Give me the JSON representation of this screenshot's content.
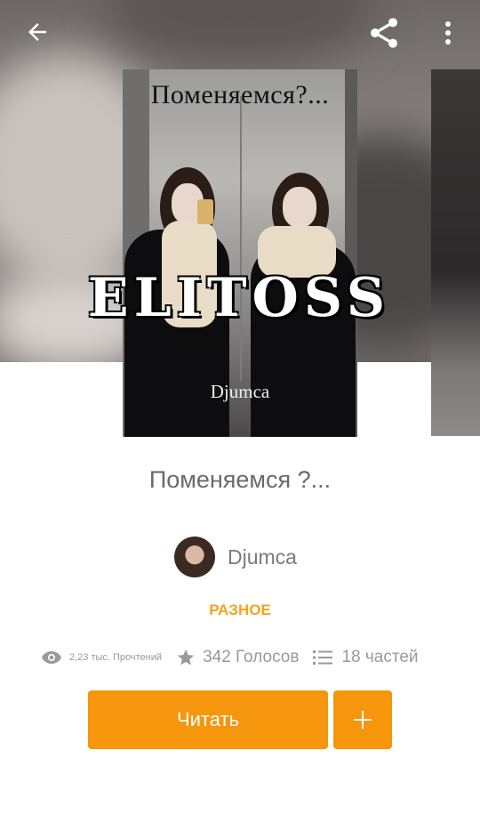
{
  "cover": {
    "title_text": "Поменяемся?...",
    "author_text": "Djumca",
    "watermark": "ELITOSS"
  },
  "story": {
    "title": "Поменяемся ?...",
    "author": "Djumca",
    "category": "РАЗНОЕ"
  },
  "stats": {
    "reads": "2,23 тыс. Прочтений",
    "votes": "342 Голосов",
    "parts": "18 частей"
  },
  "actions": {
    "read_label": "Читать",
    "add_label": "+"
  },
  "colors": {
    "accent": "#f6960c",
    "category": "#f4a21a"
  },
  "icons": [
    "back-arrow-icon",
    "share-icon",
    "more-vert-icon",
    "eye-icon",
    "star-icon",
    "list-icon",
    "plus-icon"
  ]
}
